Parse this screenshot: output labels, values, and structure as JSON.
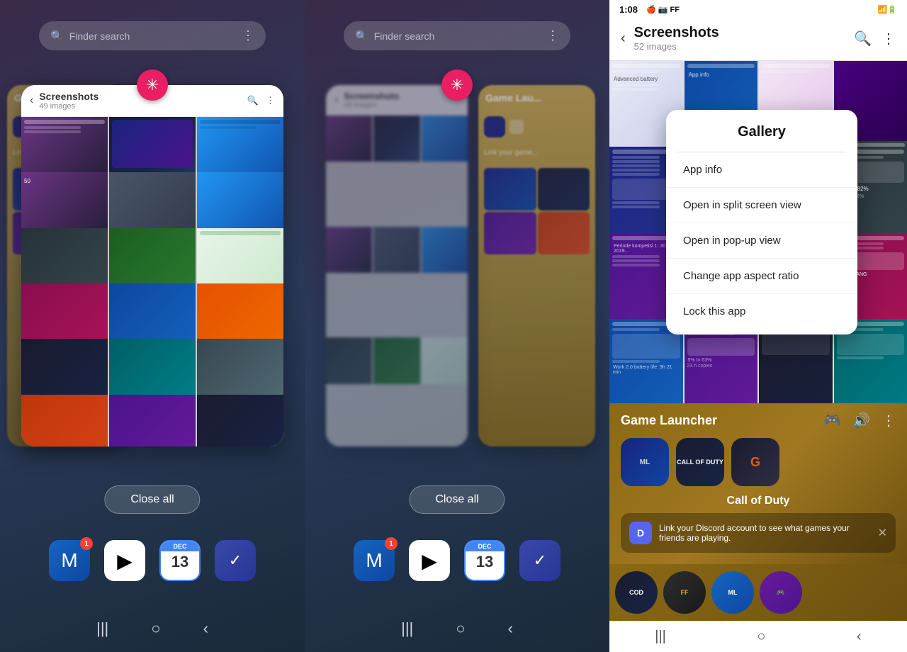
{
  "left_panel": {
    "finder": {
      "placeholder": "Finder search",
      "dots_icon": "⋮"
    },
    "phone_card": {
      "header": {
        "back": "‹",
        "title": "Screenshots",
        "count": "49 images",
        "search_icon": "🔍",
        "more_icon": "⋮"
      }
    },
    "snowflake_badge": "✳",
    "close_all_button": "Close all",
    "nav": {
      "menu": "|||",
      "home": "○",
      "back": "‹"
    },
    "dock": [
      {
        "letter": "M",
        "badge": "1",
        "color": "icon-m"
      },
      {
        "letter": "▶",
        "badge": null,
        "color": "icon-play"
      },
      {
        "letter": "13",
        "badge": null,
        "color": "icon-cal"
      },
      {
        "letter": "✓",
        "badge": null,
        "color": "icon-tasks"
      }
    ]
  },
  "middle_panel": {
    "finder": {
      "placeholder": "Finder search",
      "dots_icon": "⋮"
    },
    "context_menu": {
      "title": "Gallery",
      "items": [
        "App info",
        "Open in split screen view",
        "Open in pop-up view",
        "Change app aspect ratio",
        "Lock this app"
      ]
    },
    "snowflake_badge": "✳",
    "close_all_button": "Close all",
    "nav": {
      "menu": "|||",
      "home": "○",
      "back": "‹"
    },
    "dock": [
      {
        "letter": "M",
        "badge": "1"
      },
      {
        "letter": "▶",
        "badge": null
      },
      {
        "letter": "13",
        "badge": null
      },
      {
        "letter": "✓",
        "badge": null
      }
    ]
  },
  "right_panel": {
    "status_bar": {
      "time": "1:08",
      "icons": "📶🔋"
    },
    "header": {
      "back_icon": "‹",
      "title": "Screenshots",
      "subtitle": "52 images",
      "search_icon": "🔍",
      "more_icon": "⋮"
    },
    "game_launcher": {
      "title": "Game Launcher",
      "discord_icon": "🎮",
      "volume_icon": "🔊",
      "more_icon": "⋮",
      "game_name": "Call of Duty",
      "discord_message": "Link your Discord account to see what games your friends are playing.",
      "close_icon": "✕"
    },
    "bottom_games": [
      "Call of Duty",
      "Free Fire",
      "Mobile Legends",
      "Game 4"
    ],
    "nav": {
      "menu": "|||",
      "home": "○",
      "back": "‹"
    }
  }
}
